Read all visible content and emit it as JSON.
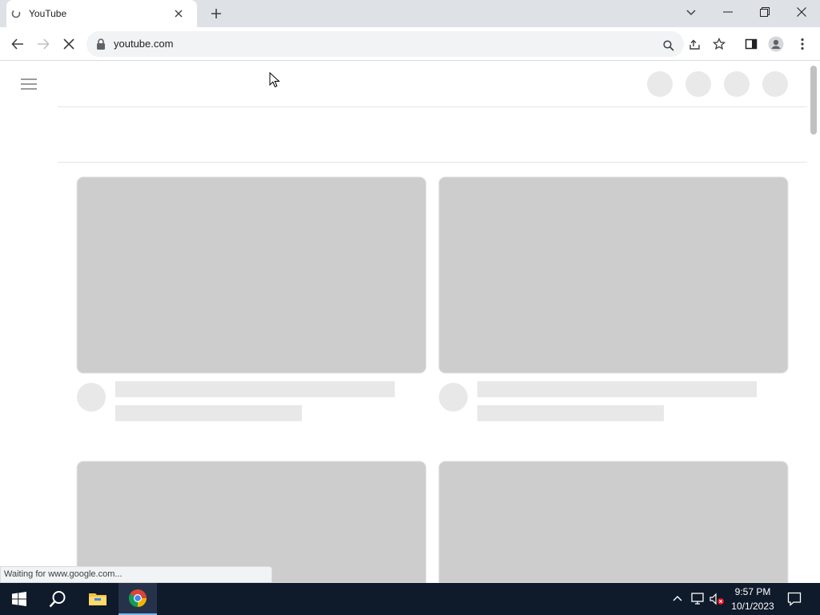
{
  "browser": {
    "tab": {
      "title": "YouTube"
    },
    "address_bar": {
      "url": "youtube.com"
    },
    "status_text": "Waiting for www.google.com..."
  },
  "page": {
    "state": "loading-skeleton"
  },
  "taskbar": {
    "time": "9:57 PM",
    "date": "10/1/2023",
    "pinned": [
      "start-icon",
      "search-icon",
      "file-explorer-icon",
      "chrome-icon"
    ]
  },
  "colors": {
    "tabstrip_bg": "#dee1e6",
    "skeleton_thumb": "#cdcdcd",
    "skeleton_line": "#e8e8e8",
    "taskbar_bg": "#0f1a2a"
  }
}
